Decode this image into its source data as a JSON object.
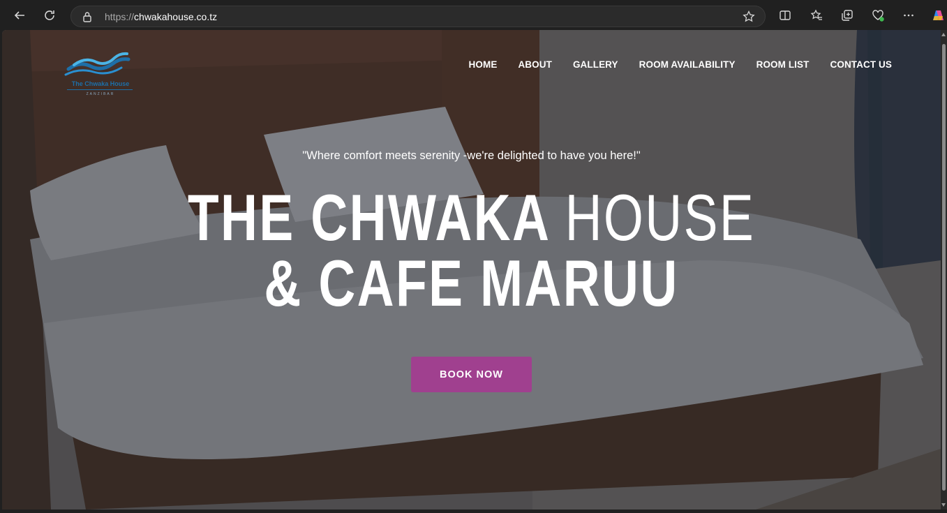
{
  "browser": {
    "url_protocol": "https://",
    "url_host": "chwakahouse.co.tz"
  },
  "site": {
    "logo": {
      "brand": "The Chwaka House",
      "sub": "ZANZIBAR"
    },
    "nav": [
      {
        "label": "HOME"
      },
      {
        "label": "ABOUT"
      },
      {
        "label": "GALLERY"
      },
      {
        "label": "ROOM AVAILABILITY"
      },
      {
        "label": "ROOM LIST"
      },
      {
        "label": "CONTACT US"
      }
    ],
    "hero": {
      "tagline": "\"Where comfort meets serenity -we're delighted to have you here!\"",
      "headline_bold_1": "THE CHWAKA",
      "headline_light_1": "HOUSE",
      "headline_line_2": "& CAFE MARUU",
      "cta_label": "BOOK NOW"
    }
  },
  "colors": {
    "accent": "#a0408f",
    "logo_blue": "#1d6fa8",
    "chrome_bg": "#202020"
  }
}
